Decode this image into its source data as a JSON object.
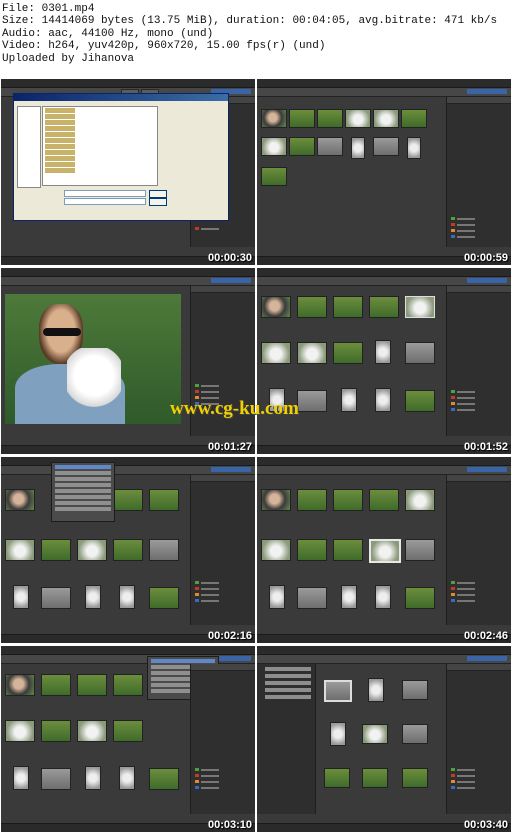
{
  "info": {
    "file": "File: 0301.mp4",
    "size": "Size: 14414069 bytes (13.75 MiB), duration: 00:04:05, avg.bitrate: 471 kb/s",
    "audio": "Audio: aac, 44100 Hz, mono (und)",
    "video": "Video: h264, yuv420p, 960x720, 15.00 fps(r) (und)",
    "uploader": "Uploaded by Jihanova"
  },
  "watermark": "www.cg-ku.com",
  "frames": [
    {
      "timestamp": "00:00:30",
      "view": "import-dialog"
    },
    {
      "timestamp": "00:00:59",
      "view": "media-browser"
    },
    {
      "timestamp": "00:01:27",
      "view": "single-photo"
    },
    {
      "timestamp": "00:01:52",
      "view": "thumbnail-grid"
    },
    {
      "timestamp": "00:02:16",
      "view": "context-menu"
    },
    {
      "timestamp": "00:02:46",
      "view": "thumbnail-grid-selected"
    },
    {
      "timestamp": "00:03:10",
      "view": "dropdown-menu"
    },
    {
      "timestamp": "00:03:40",
      "view": "folder-view"
    }
  ],
  "colors": {
    "panel": "#3a3a3a",
    "accent": "#3a64a8",
    "timestamp": "#ffffff",
    "watermark": "#f0d000",
    "tag_green": "#4aa33a",
    "tag_red": "#c23a2a",
    "tag_orange": "#e08a2a",
    "tag_blue": "#3a6ac2"
  }
}
